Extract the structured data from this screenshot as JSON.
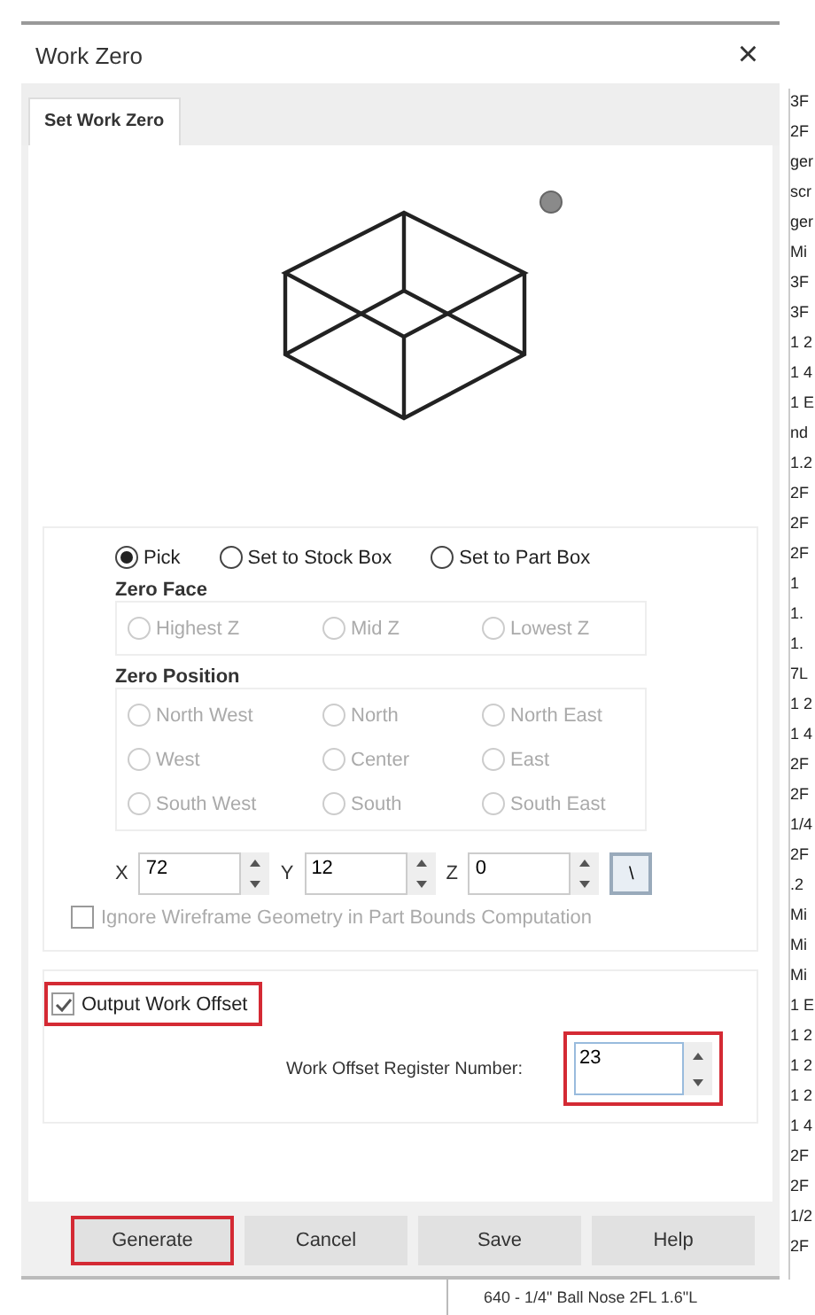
{
  "window": {
    "title": "Work Zero",
    "close": "×"
  },
  "tabs": [
    {
      "label": "Set Work Zero",
      "selected": true
    }
  ],
  "mode_options": [
    {
      "label": "Pick",
      "selected": true
    },
    {
      "label": "Set to Stock Box",
      "selected": false
    },
    {
      "label": "Set to Part Box",
      "selected": false
    }
  ],
  "zero_face": {
    "title": "Zero Face",
    "disabled": true,
    "options": [
      {
        "label": "Highest Z",
        "selected": false
      },
      {
        "label": "Mid Z",
        "selected": false
      },
      {
        "label": "Lowest Z",
        "selected": false
      }
    ]
  },
  "zero_position": {
    "title": "Zero Position",
    "disabled": true,
    "options": [
      {
        "label": "North West",
        "selected": false
      },
      {
        "label": "North",
        "selected": false
      },
      {
        "label": "North East",
        "selected": false
      },
      {
        "label": "West",
        "selected": false
      },
      {
        "label": "Center",
        "selected": false
      },
      {
        "label": "East",
        "selected": false
      },
      {
        "label": "South West",
        "selected": false
      },
      {
        "label": "South",
        "selected": false
      },
      {
        "label": "South East",
        "selected": false
      }
    ]
  },
  "coordinates": [
    {
      "label": "X",
      "value": "72"
    },
    {
      "label": "Y",
      "value": "12"
    },
    {
      "label": "Z",
      "value": "0"
    }
  ],
  "pick_button": {
    "label": "\\"
  },
  "ignore_wireframe": {
    "label": "Ignore Wireframe Geometry in Part Bounds Computation",
    "checked": false,
    "disabled": true
  },
  "output_work_offset": {
    "label": "Output Work Offset",
    "checked": true,
    "highlighted": true
  },
  "register_number": {
    "label": "Work Offset Register Number:",
    "value": "23",
    "highlighted": true
  },
  "buttons": [
    {
      "label": "Generate",
      "highlighted": true
    },
    {
      "label": "Cancel",
      "highlighted": false
    },
    {
      "label": "Save",
      "highlighted": false
    },
    {
      "label": "Help",
      "highlighted": false
    }
  ],
  "background_list": [
    "3F",
    "2F",
    "ger",
    "scr",
    "ger",
    "Mi",
    "3F",
    "3F",
    "1 2",
    "1 4",
    "1 E",
    "nd",
    "1.2",
    "2F",
    "2F",
    "2F",
    "1",
    "1.",
    "1.",
    "7L",
    "1 2",
    "1 4",
    "2F",
    "2F",
    "1/4",
    "2F",
    ".2",
    "Mi",
    "Mi",
    "Mi",
    "1 E",
    "1 2",
    "1 2",
    "1 2",
    "1 4",
    "2F",
    "2F",
    "1/2",
    "2F"
  ],
  "background_row": "640 - 1/4\" Ball Nose 2FL 1.6\"L"
}
